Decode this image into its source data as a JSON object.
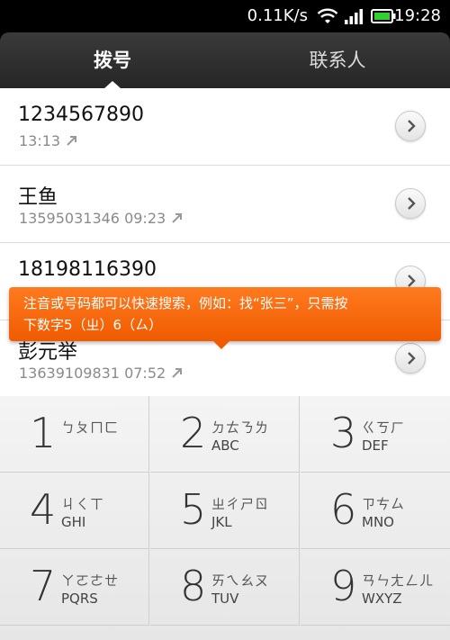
{
  "status_bar": {
    "network_speed": "0.11K/s",
    "time": "19:28"
  },
  "tabs": [
    {
      "label": "拨号",
      "active": true
    },
    {
      "label": "联系人",
      "active": false
    }
  ],
  "call_log": [
    {
      "number": "1234567890",
      "meta": "13:13",
      "direction": "outgoing"
    },
    {
      "number": "王鱼",
      "meta": "13595031346 09:23",
      "direction": "outgoing"
    },
    {
      "number": "18198116390",
      "meta": "",
      "direction": "outgoing"
    },
    {
      "number": "彭元举",
      "meta": "13639109831 07:52",
      "direction": "outgoing"
    }
  ],
  "tooltip": {
    "line1": "注音或号码都可以快速搜索，例如：找“张三”，只需按",
    "line2": "下数字5（ㄓ）6（ㄙ）"
  },
  "keypad": [
    {
      "digit": "1",
      "zhuyin": "ㄅㄆㄇㄈ",
      "letters": ""
    },
    {
      "digit": "2",
      "zhuyin": "ㄉㄊㄋㄌ",
      "letters": "ABC"
    },
    {
      "digit": "3",
      "zhuyin": "ㄍㄎㄏ",
      "letters": "DEF"
    },
    {
      "digit": "4",
      "zhuyin": "ㄐㄑㄒ",
      "letters": "GHI"
    },
    {
      "digit": "5",
      "zhuyin": "ㄓㄔㄕㄖ",
      "letters": "JKL"
    },
    {
      "digit": "6",
      "zhuyin": "ㄗㄘㄙ",
      "letters": "MNO"
    },
    {
      "digit": "7",
      "zhuyin": "ㄚㄛㄜㄝ",
      "letters": "PQRS"
    },
    {
      "digit": "8",
      "zhuyin": "ㄞㄟㄠㄡ",
      "letters": "TUV"
    },
    {
      "digit": "9",
      "zhuyin": "ㄢㄣㄤㄥㄦ",
      "letters": "WXYZ"
    }
  ],
  "colors": {
    "tooltip": "#f26500",
    "tab_bar": "#2e2e2e"
  }
}
